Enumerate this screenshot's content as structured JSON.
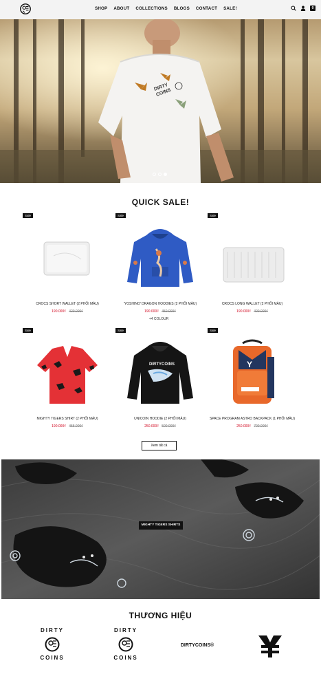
{
  "nav": [
    "SHOP",
    "ABOUT",
    "COLLECTIONS",
    "BLOGS",
    "CONTACT",
    "SALE!"
  ],
  "header": {
    "logo_icon": "dirtycoins-logo-icon",
    "search_icon": "search-icon",
    "account_icon": "user-icon",
    "cart_icon": "cart-icon",
    "cart_count": "0"
  },
  "hero": {
    "slide_count": 3,
    "active_slide": 3,
    "shirt_print": "DIRTY COINS"
  },
  "quick_sale": {
    "title": "QUICK SALE!",
    "badge": "Sale",
    "products": [
      {
        "name": "CROCS SHORT WALLET (2 PHỐI MÀU)",
        "price": "190.000₫",
        "old_price": "420.000₫"
      },
      {
        "name": "'YOSHINO' DRAGON HOODIES (2 PHỐI MÀU)",
        "price": "190.000₫",
        "old_price": "450.000₫"
      },
      {
        "name": "CROCS LONG WALLET (2 PHỐI MÀU)",
        "price": "190.000₫",
        "old_price": "400.000₫"
      },
      {
        "name": "MIGHTY TIGERS SHIRT (2 PHỐI MÀU)",
        "price": "190.000₫",
        "old_price": "455.000₫"
      },
      {
        "name": "UNICOIN HOODIE (2 PHỐI MÀU)",
        "price": "250.000₫",
        "old_price": "500.000₫"
      },
      {
        "name": "SPACE PROGRAM ASTRO BACKPACK (1 PHỐI MÀU)",
        "price": "250.000₫",
        "old_price": "700.000₫"
      }
    ],
    "colour_note": "+4 COLOUR",
    "more_label": "Xem tất cả"
  },
  "banner": {
    "button_label": "MIGHTY TIGERS SHIRTS"
  },
  "brands": {
    "title": "THƯƠNG HIỆU",
    "logos": [
      {
        "top": "DIRTY",
        "bottom": "COINS"
      },
      {
        "top": "DIRTY",
        "bottom": "COINS"
      },
      {
        "text": "DIRTYCOINS®"
      },
      {
        "icon": "y-monogram-icon"
      }
    ]
  },
  "colors": {
    "sale_red": "#d0021b",
    "badge_black": "#111111",
    "header_bg": "#f3f3f3"
  }
}
